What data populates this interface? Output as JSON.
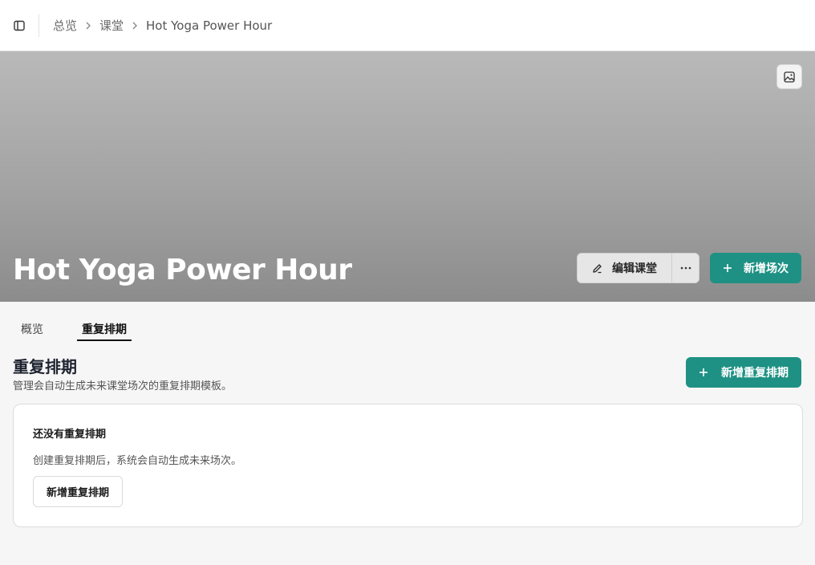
{
  "breadcrumb": {
    "overview": "总览",
    "classes": "课堂",
    "current": "Hot Yoga Power Hour"
  },
  "hero": {
    "title": "Hot Yoga Power Hour",
    "edit_label": "编辑课堂",
    "add_session_label": "新增场次"
  },
  "tabs": [
    {
      "label": "概览"
    },
    {
      "label": "重复排期"
    }
  ],
  "section": {
    "title": "重复排期",
    "description": "管理会自动生成未来课堂场次的重复排期模板。",
    "add_label": "新增重复排期"
  },
  "empty_state": {
    "title": "还没有重复排期",
    "description": "创建重复排期后，系统会自动生成未来场次。",
    "button_label": "新增重复排期"
  },
  "colors": {
    "primary": "#1e9184",
    "hero_top": "#b9b9b9",
    "hero_bottom": "#8c8c8c"
  },
  "icons": [
    "sidebar-icon",
    "chevron-right-icon",
    "image-icon",
    "pencil-icon",
    "ellipsis-icon",
    "plus-icon"
  ]
}
